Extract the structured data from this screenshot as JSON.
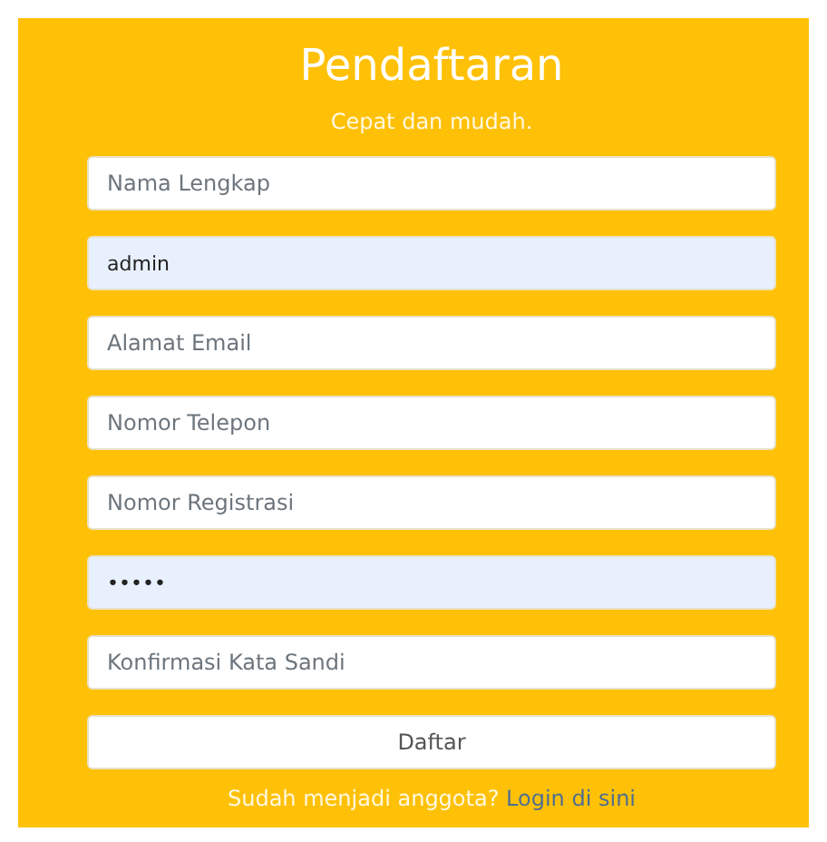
{
  "title": "Pendaftaran",
  "subtitle": "Cepat dan mudah.",
  "fields": [
    {
      "placeholder": "Nama Lengkap",
      "autofilled": false
    },
    {
      "value": "admin",
      "autofilled": true
    },
    {
      "placeholder": "Alamat Email",
      "autofilled": false
    },
    {
      "placeholder": "Nomor Telepon",
      "autofilled": false
    },
    {
      "placeholder": "Nomor Registrasi",
      "autofilled": false
    },
    {
      "value": "•••••",
      "autofilled": true
    },
    {
      "placeholder": "Konfirmasi Kata Sandi",
      "autofilled": false
    }
  ],
  "submit_button": "Daftar",
  "footer": {
    "text": "Sudah menjadi anggota?",
    "link": "Login di sini"
  }
}
